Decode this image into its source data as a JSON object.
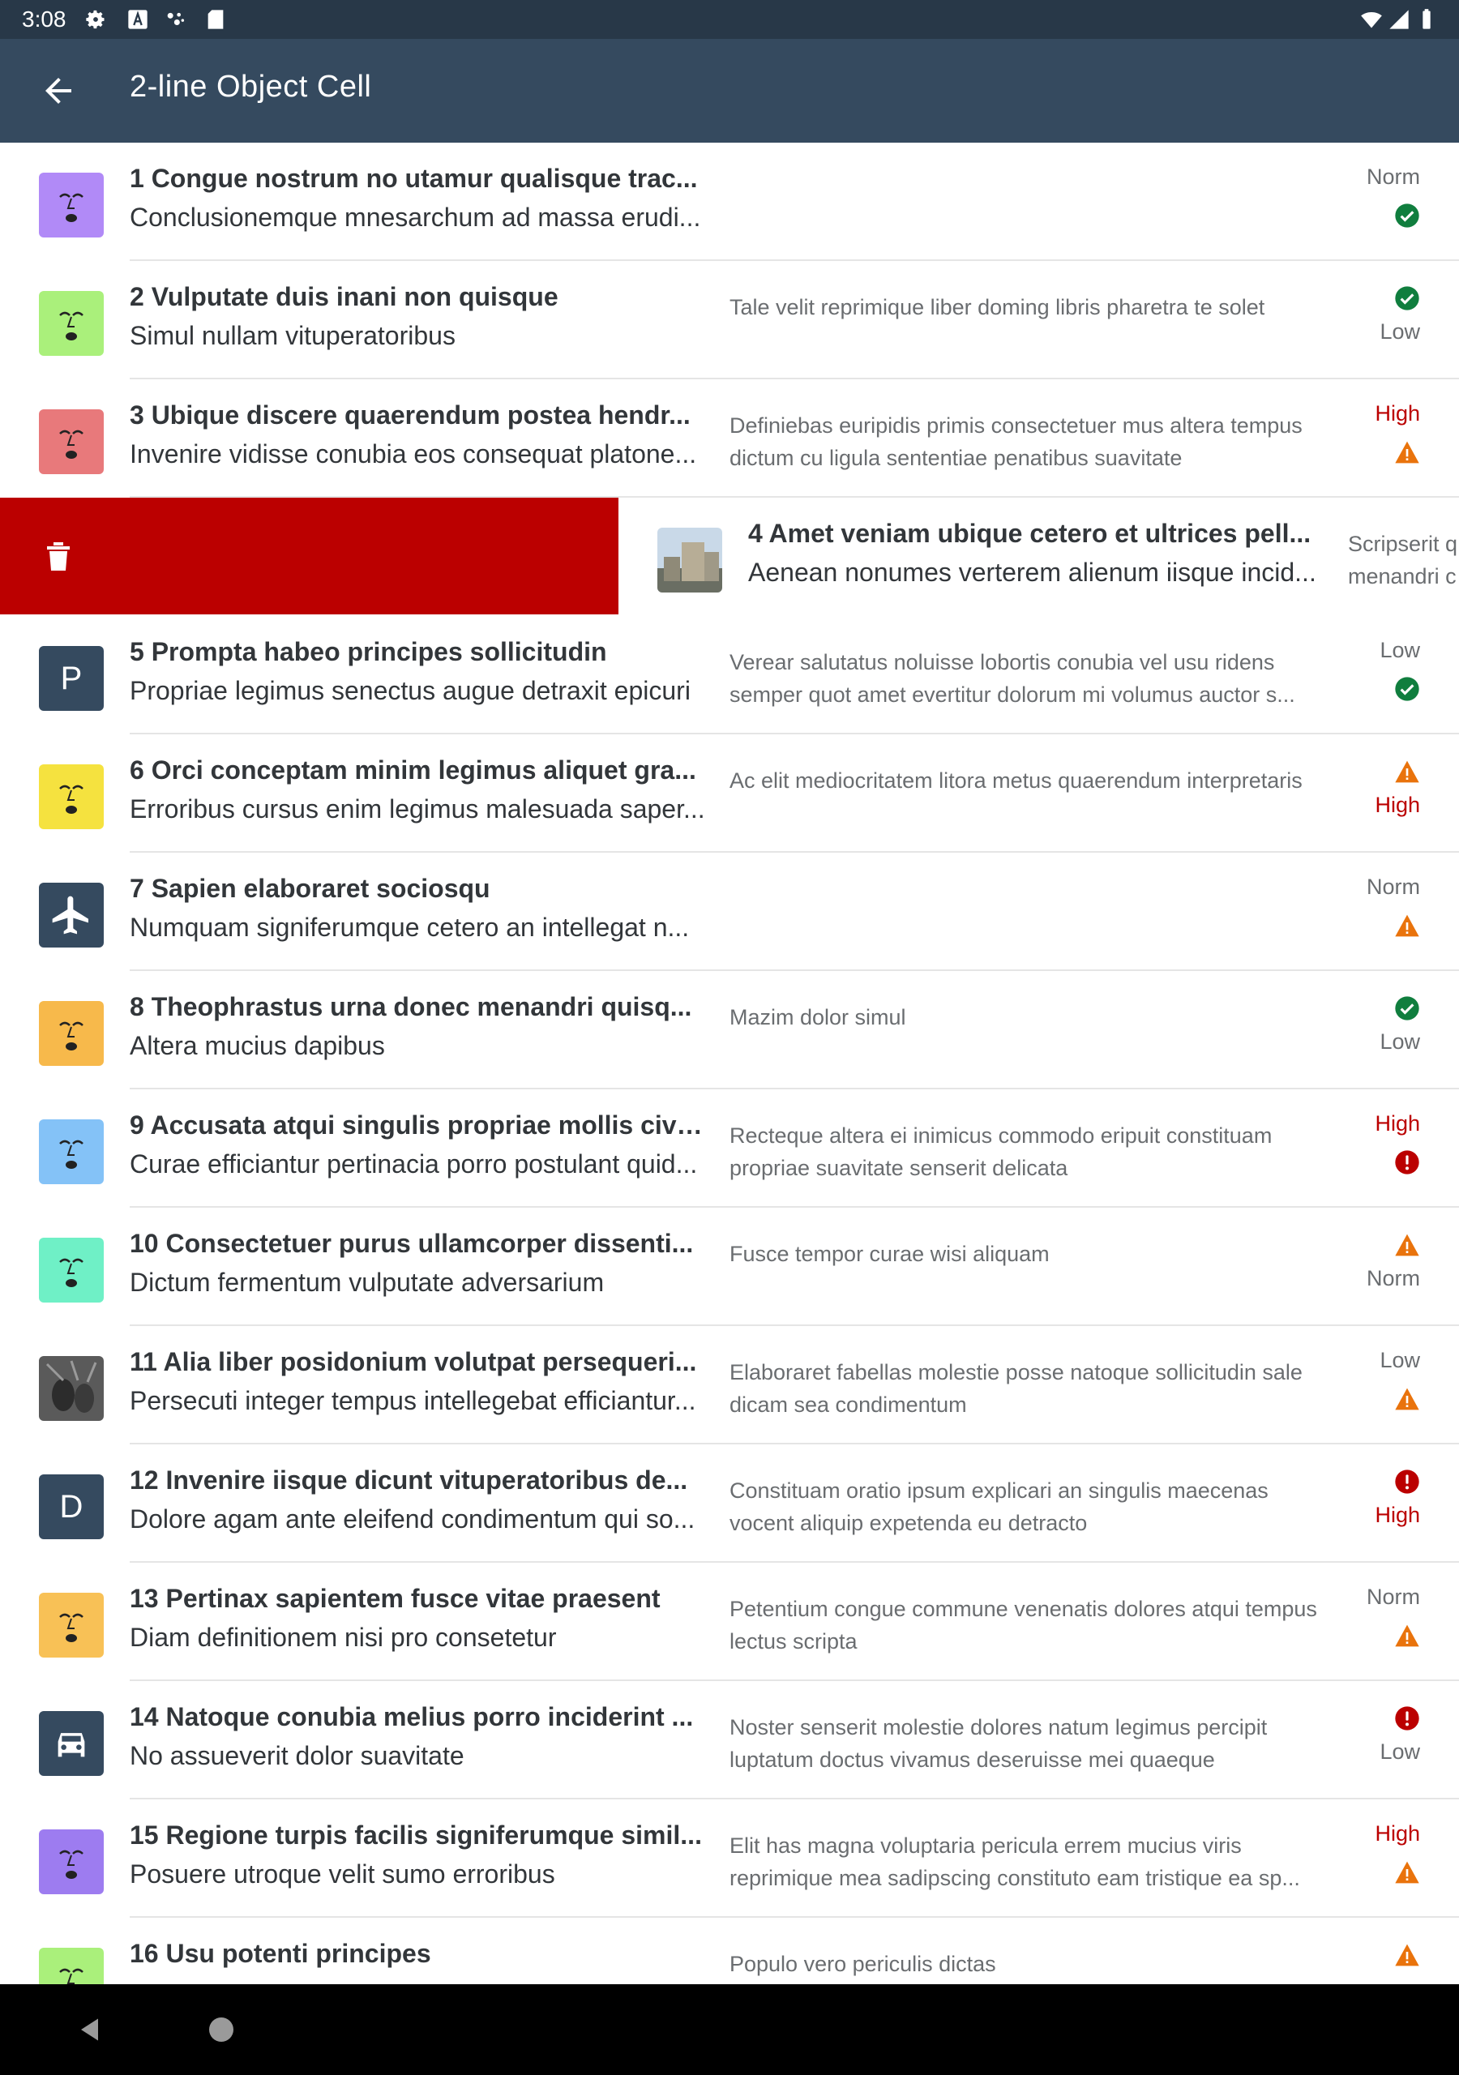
{
  "status_bar": {
    "time": "3:08"
  },
  "app_bar": {
    "title": "2-line Object Cell"
  },
  "swipe_action": {
    "icon": "trash-icon",
    "color": "#bb0000"
  },
  "items": [
    {
      "title": "1 Congue nostrum no utamur qualisque trac...",
      "subtitle": "Conclusionemque mnesarchum ad massa erudi...",
      "description": "",
      "status_top": "Norm",
      "status_top_icon": "",
      "status_bottom": "",
      "status_bottom_icon": "check-icon",
      "thumb": "face-purple"
    },
    {
      "title": "2 Vulputate duis inani non quisque",
      "subtitle": "Simul nullam vituperatoribus",
      "description": "Tale velit reprimique liber doming libris pharetra te solet",
      "status_top": "",
      "status_top_icon": "check-icon",
      "status_bottom": "Low",
      "status_bottom_icon": "",
      "thumb": "face-green"
    },
    {
      "title": "3 Ubique discere quaerendum postea hendr...",
      "subtitle": "Invenire vidisse conubia eos consequat platone...",
      "description": "Definiebas euripidis primis consectetuer mus altera tempus dictum cu ligula sententiae penatibus suavitate",
      "status_top": "High",
      "status_top_icon": "",
      "status_bottom": "",
      "status_bottom_icon": "warning-icon",
      "thumb": "face-red"
    },
    {
      "title": "4 Amet veniam ubique cetero et ultrices pell...",
      "subtitle": "Aenean nonumes verterem alienum iisque incid...",
      "description": "Scripserit q menandri c",
      "status_top": "",
      "status_top_icon": "",
      "status_bottom": "",
      "status_bottom_icon": "",
      "thumb": "photo-building"
    },
    {
      "title": "5 Prompta habeo principes sollicitudin",
      "subtitle": "Propriae legimus senectus augue detraxit epicuri",
      "description": "Verear salutatus noluisse lobortis conubia vel usu ridens semper quot amet evertitur dolorum mi volumus auctor s...",
      "status_top": "Low",
      "status_top_icon": "",
      "status_bottom": "",
      "status_bottom_icon": "check-icon",
      "thumb": "P"
    },
    {
      "title": "6 Orci conceptam minim legimus aliquet gra...",
      "subtitle": "Erroribus cursus enim legimus malesuada saper...",
      "description": "Ac elit mediocritatem litora metus quaerendum interpretaris",
      "status_top": "",
      "status_top_icon": "warning-icon",
      "status_bottom": "High",
      "status_bottom_icon": "",
      "thumb": "face-yellow"
    },
    {
      "title": "7 Sapien elaboraret sociosqu",
      "subtitle": "Numquam signiferumque cetero an intellegat n...",
      "description": "",
      "status_top": "Norm",
      "status_top_icon": "",
      "status_bottom": "",
      "status_bottom_icon": "warning-icon",
      "thumb": "airplane-icon"
    },
    {
      "title": "8 Theophrastus urna donec menandri quisq...",
      "subtitle": "Altera mucius dapibus",
      "description": "Mazim dolor simul",
      "status_top": "",
      "status_top_icon": "check-icon",
      "status_bottom": "Low",
      "status_bottom_icon": "",
      "thumb": "face-orange"
    },
    {
      "title": "9 Accusata atqui singulis propriae mollis civi...",
      "subtitle": "Curae efficiantur pertinacia porro postulant quid...",
      "description": "Recteque altera ei inimicus commodo eripuit constituam propriae suavitate senserit delicata",
      "status_top": "High",
      "status_top_icon": "",
      "status_bottom": "",
      "status_bottom_icon": "error-icon",
      "thumb": "face-blue"
    },
    {
      "title": "10 Consectetuer purus ullamcorper dissenti...",
      "subtitle": "Dictum fermentum vulputate adversarium",
      "description": "Fusce tempor curae wisi aliquam",
      "status_top": "",
      "status_top_icon": "warning-icon",
      "status_bottom": "Norm",
      "status_bottom_icon": "",
      "thumb": "face-teal"
    },
    {
      "title": "11 Alia liber posidonium volutpat persequeri...",
      "subtitle": "Persecuti integer tempus intellegebat efficiantur...",
      "description": "Elaboraret fabellas molestie posse natoque sollicitudin sale dicam sea condimentum",
      "status_top": "Low",
      "status_top_icon": "",
      "status_bottom": "",
      "status_bottom_icon": "warning-icon",
      "thumb": "photo-pinecones"
    },
    {
      "title": "12 Invenire iisque dicunt vituperatoribus de...",
      "subtitle": "Dolore agam ante eleifend condimentum qui so...",
      "description": "Constituam oratio ipsum explicari an singulis maecenas vocent aliquip expetenda eu detracto",
      "status_top": "",
      "status_top_icon": "error-icon",
      "status_bottom": "High",
      "status_bottom_icon": "",
      "thumb": "D"
    },
    {
      "title": "13 Pertinax sapientem fusce vitae praesent",
      "subtitle": "Diam definitionem nisi pro consetetur",
      "description": "Petentium congue commune venenatis dolores atqui tempus lectus scripta",
      "status_top": "Norm",
      "status_top_icon": "",
      "status_bottom": "",
      "status_bottom_icon": "warning-icon",
      "thumb": "face-amber"
    },
    {
      "title": "14 Natoque conubia melius porro inciderint ...",
      "subtitle": "No assueverit dolor suavitate",
      "description": "Noster senserit molestie dolores natum legimus percipit luptatum doctus vivamus deseruisse mei quaeque",
      "status_top": "",
      "status_top_icon": "error-icon",
      "status_bottom": "Low",
      "status_bottom_icon": "",
      "thumb": "car-icon"
    },
    {
      "title": "15 Regione turpis facilis signiferumque simil...",
      "subtitle": "Posuere utroque velit sumo erroribus",
      "description": "Elit has magna voluptaria pericula errem mucius viris reprimique mea sadipscing constituto eam tristique ea sp...",
      "status_top": "High",
      "status_top_icon": "",
      "status_bottom": "",
      "status_bottom_icon": "warning-icon",
      "thumb": "face-violet"
    },
    {
      "title": "16 Usu potenti principes",
      "subtitle": "",
      "description": "Populo vero periculis dictas",
      "status_top": "",
      "status_top_icon": "warning-icon",
      "status_bottom": "",
      "status_bottom_icon": "",
      "thumb": "face-green"
    }
  ],
  "colors": {
    "status_bar": "#283848",
    "app_bar": "#354a5f",
    "high": "#bb0000",
    "warning": "#e9730c",
    "success": "#107e3e",
    "swipe_delete": "#bb0000"
  }
}
